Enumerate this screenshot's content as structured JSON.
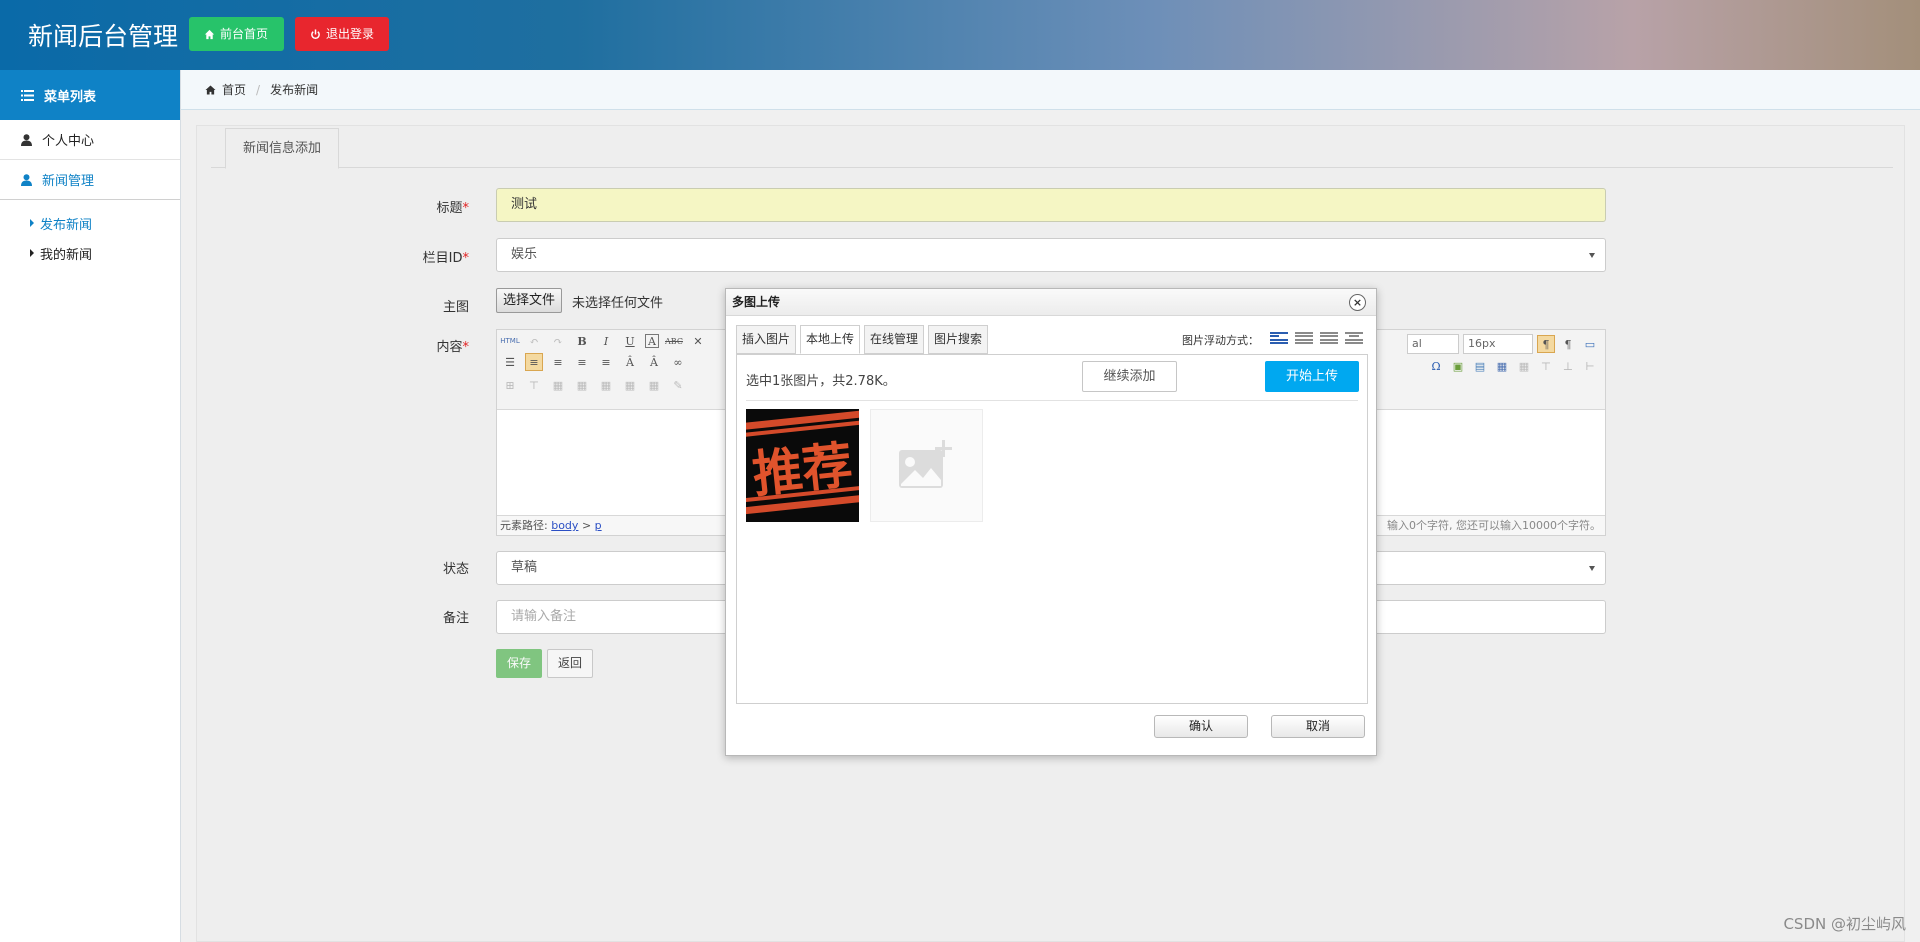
{
  "header": {
    "brand": "新闻后台管理",
    "home_button": "前台首页",
    "logout_button": "退出登录"
  },
  "sidebar": {
    "title": "菜单列表",
    "items": [
      {
        "label": "个人中心"
      },
      {
        "label": "新闻管理"
      }
    ],
    "sub_items": [
      {
        "label": "发布新闻"
      },
      {
        "label": "我的新闻"
      }
    ]
  },
  "breadcrumb": {
    "home": "首页",
    "current": "发布新闻"
  },
  "main": {
    "tab": "新闻信息添加",
    "form": {
      "title_label": "标题",
      "title_value": "测试",
      "column_label": "栏目ID",
      "column_value": "娱乐",
      "image_label": "主图",
      "file_button": "选择文件",
      "file_status": "未选择任何文件",
      "content_label": "内容",
      "status_label": "状态",
      "status_value": "草稿",
      "remark_label": "备注",
      "remark_placeholder": "请输入备注",
      "required_mark": "*"
    },
    "editor": {
      "path_label": "元素路径:",
      "path_body": "body",
      "path_sep": ">",
      "path_p": "p",
      "count_text": "输入0个字符, 您还可以输入10000个字符。",
      "font_family": "al",
      "font_size": "16px"
    },
    "save_button": "保存",
    "back_button": "返回"
  },
  "dialog": {
    "title": "多图上传",
    "close": "×",
    "tabs": [
      {
        "label": "插入图片"
      },
      {
        "label": "本地上传"
      },
      {
        "label": "在线管理"
      },
      {
        "label": "图片搜索"
      }
    ],
    "float_label": "图片浮动方式：",
    "upload_info": "选中1张图片，共2.78K。",
    "continue_button": "继续添加",
    "start_button": "开始上传",
    "thumb_text": "推荐",
    "ok_button": "确认",
    "cancel_button": "取消"
  },
  "watermark": "CSDN @初尘屿风",
  "colors": {
    "accent_blue": "#0f82c6",
    "home_green": "#27c36a",
    "logout_red": "#e8262e",
    "upload_blue": "#00a8f0"
  }
}
